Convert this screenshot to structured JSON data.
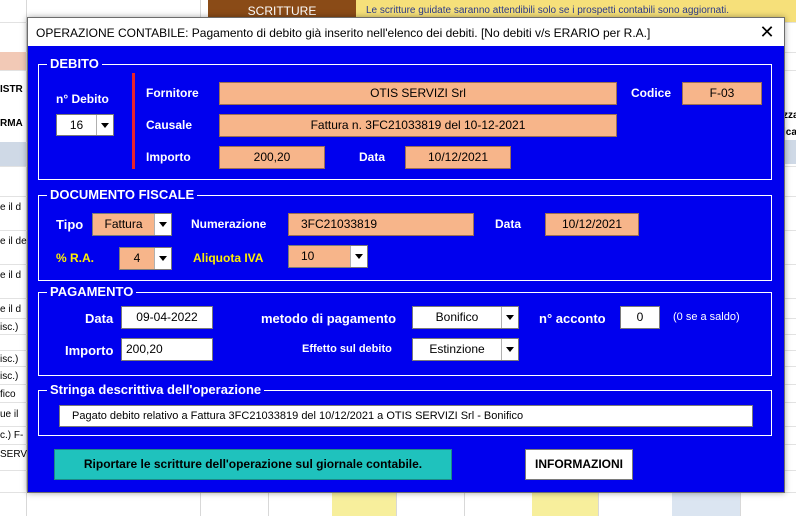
{
  "background": {
    "top_button": "SCRITTURE",
    "top_notice": "Le scritture guidate saranno attendibili solo se i prospetti contabili sono aggiornati.",
    "left_fragments": [
      "ISTR",
      "RMA",
      "e il d",
      "e il de",
      "e il d",
      "e il d",
      "isc.)",
      "isc.)",
      "isc.)",
      "fico",
      "ue il",
      "c.) F-",
      "SERV"
    ],
    "right_fragments": [
      "zza",
      "ica"
    ]
  },
  "dialog": {
    "title": "OPERAZIONE CONTABILE: Pagamento di debito già inserito nell'elenco dei debiti. [No debiti v/s ERARIO per R.A.]",
    "close_label": "✕",
    "debito": {
      "section_title": "DEBITO",
      "n_debito_label": "n° Debito",
      "n_debito_value": "16",
      "fornitore_label": "Fornitore",
      "fornitore_value": "OTIS SERVIZI Srl",
      "codice_label": "Codice",
      "codice_value": "F-03",
      "causale_label": "Causale",
      "causale_value": "Fattura n. 3FC21033819 del 10-12-2021",
      "importo_label": "Importo",
      "importo_value": "200,20",
      "data_label": "Data",
      "data_value": "10/12/2021"
    },
    "documento_fiscale": {
      "section_title": "DOCUMENTO FISCALE",
      "tipo_label": "Tipo",
      "tipo_value": "Fattura",
      "numerazione_label": "Numerazione",
      "numerazione_value": "3FC21033819",
      "data_label": "Data",
      "data_value": "10/12/2021",
      "ra_label": "% R.A.",
      "ra_value": "4",
      "aliquota_label": "Aliquota IVA",
      "aliquota_value": "10"
    },
    "pagamento": {
      "section_title": "PAGAMENTO",
      "data_label": "Data",
      "data_value": "09-04-2022",
      "metodo_label": "metodo di pagamento",
      "metodo_value": "Bonifico",
      "acconto_label": "n° acconto",
      "acconto_value": "0",
      "acconto_hint": "(0 se a saldo)",
      "importo_label": "Importo",
      "importo_value": "200,20",
      "effetto_label": "Effetto sul debito",
      "effetto_value": "Estinzione"
    },
    "stringa": {
      "section_title": "Stringa descrittiva dell'operazione",
      "value": "Pagato debito relativo a Fattura  3FC21033819  del 10/12/2021 a OTIS SERVIZI Srl - Bonifico"
    },
    "buttons": {
      "riportare": "Riportare le scritture dell'operazione sul giornale contabile.",
      "informazioni": "INFORMAZIONI"
    }
  }
}
